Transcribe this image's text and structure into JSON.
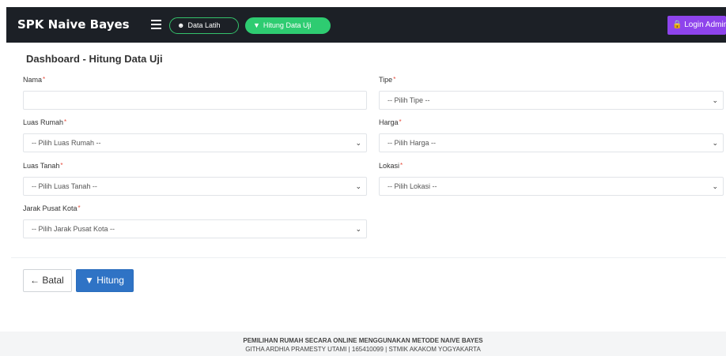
{
  "navbar": {
    "brand": "SPK Naive Bayes",
    "data_latih": "Data Latih",
    "hitung_data_uji": "Hitung Data Uji",
    "login": "Login Admin"
  },
  "page": {
    "title": "Dashboard - Hitung Data Uji"
  },
  "form": {
    "nama": {
      "label": "Nama",
      "value": ""
    },
    "tipe": {
      "label": "Tipe",
      "selected": "-- Pilih Tipe --"
    },
    "luas_rumah": {
      "label": "Luas Rumah",
      "selected": "-- Pilih Luas Rumah --"
    },
    "harga": {
      "label": "Harga",
      "selected": "-- Pilih Harga --"
    },
    "luas_tanah": {
      "label": "Luas Tanah",
      "selected": "-- Pilih Luas Tanah --"
    },
    "lokasi": {
      "label": "Lokasi",
      "selected": "-- Pilih Lokasi --"
    },
    "jarak_pusat_kota": {
      "label": "Jarak Pusat Kota",
      "selected": "-- Pilih Jarak Pusat Kota --"
    },
    "required_mark": "*"
  },
  "buttons": {
    "batal": "Batal",
    "hitung": "Hitung"
  },
  "footer": {
    "line1": "PEMILIHAN RUMAH SECARA ONLINE MENGGUNAKAN METODE NAIVE BAYES",
    "line2": "GITHA ARDHIA PRAMESTY UTAMI | 165410099 | STMIK AKAKOM YOGYAKARTA"
  },
  "colors": {
    "navbar_bg": "#1c2026",
    "accent_green": "#2ecc71",
    "login_purple": "#8e44ec",
    "primary_blue": "#2f73c5",
    "required_red": "#e74c3c"
  },
  "icons": {
    "menu": "hamburger-icon",
    "data_latih": "users-icon",
    "hitung": "filter-icon",
    "login": "lock-icon",
    "batal": "arrow-left-icon",
    "select": "chevron-down-icon"
  }
}
